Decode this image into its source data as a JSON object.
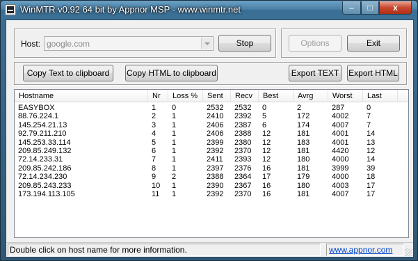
{
  "window": {
    "title": "WinMTR v0.92 64 bit by Appnor MSP - www.winmtr.net",
    "controls": {
      "minimize": "–",
      "maximize": "□",
      "close": "x"
    }
  },
  "host": {
    "label": "Host:",
    "value": "google.com"
  },
  "buttons": {
    "stop": "Stop",
    "options": "Options",
    "exit": "Exit",
    "copy_text": "Copy Text to clipboard",
    "copy_html": "Copy HTML to clipboard",
    "export_text": "Export TEXT",
    "export_html": "Export HTML"
  },
  "table": {
    "columns": [
      "Hostname",
      "Nr",
      "Loss %",
      "Sent",
      "Recv",
      "Best",
      "Avrg",
      "Worst",
      "Last"
    ],
    "rows": [
      [
        "EASYBOX",
        "1",
        "0",
        "2532",
        "2532",
        "0",
        "2",
        "287",
        "0"
      ],
      [
        "88.76.224.1",
        "2",
        "1",
        "2410",
        "2392",
        "5",
        "172",
        "4002",
        "7"
      ],
      [
        "145.254.21.13",
        "3",
        "1",
        "2406",
        "2387",
        "6",
        "174",
        "4007",
        "7"
      ],
      [
        "92.79.211.210",
        "4",
        "1",
        "2406",
        "2388",
        "12",
        "181",
        "4001",
        "14"
      ],
      [
        "145.253.33.114",
        "5",
        "1",
        "2399",
        "2380",
        "12",
        "183",
        "4001",
        "13"
      ],
      [
        "209.85.249.132",
        "6",
        "1",
        "2392",
        "2370",
        "12",
        "181",
        "4420",
        "12"
      ],
      [
        "72.14.233.31",
        "7",
        "1",
        "2411",
        "2393",
        "12",
        "180",
        "4000",
        "14"
      ],
      [
        "209.85.242.186",
        "8",
        "1",
        "2397",
        "2376",
        "16",
        "181",
        "3999",
        "39"
      ],
      [
        "72.14.234.230",
        "9",
        "2",
        "2388",
        "2364",
        "17",
        "179",
        "4000",
        "18"
      ],
      [
        "209.85.243.233",
        "10",
        "1",
        "2390",
        "2367",
        "16",
        "180",
        "4003",
        "17"
      ],
      [
        "173.194.113.105",
        "11",
        "1",
        "2392",
        "2370",
        "16",
        "181",
        "4007",
        "17"
      ]
    ]
  },
  "status": {
    "message": "Double click on host name for more information.",
    "link": "www.appnor.com"
  }
}
